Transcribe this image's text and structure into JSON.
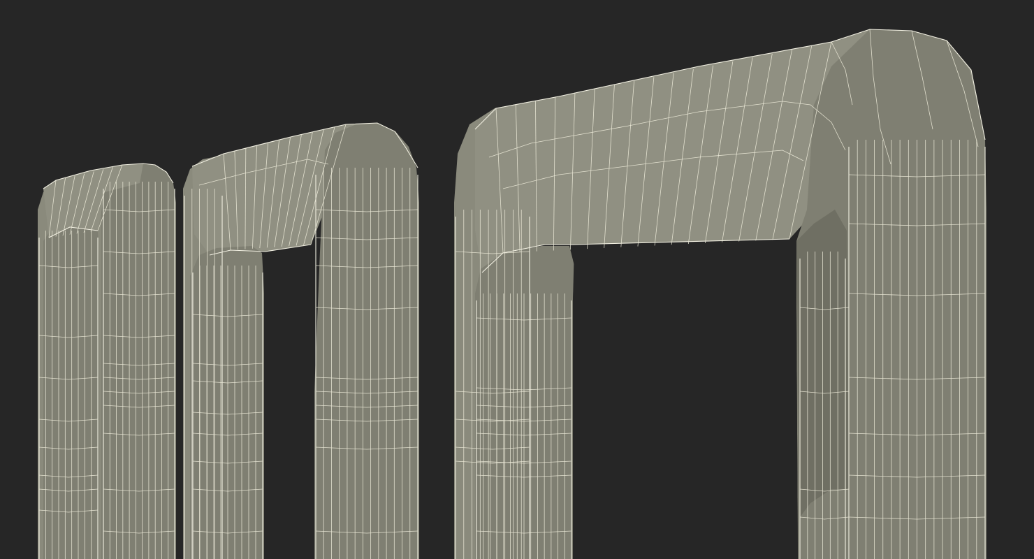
{
  "scene": {
    "background_color": "#262626",
    "mesh_fill_color": "#7f7f72",
    "wire_color": "#f2f0e2",
    "objects": [
      {
        "name": "small-handle"
      },
      {
        "name": "medium-handle"
      },
      {
        "name": "large-handle"
      }
    ]
  }
}
